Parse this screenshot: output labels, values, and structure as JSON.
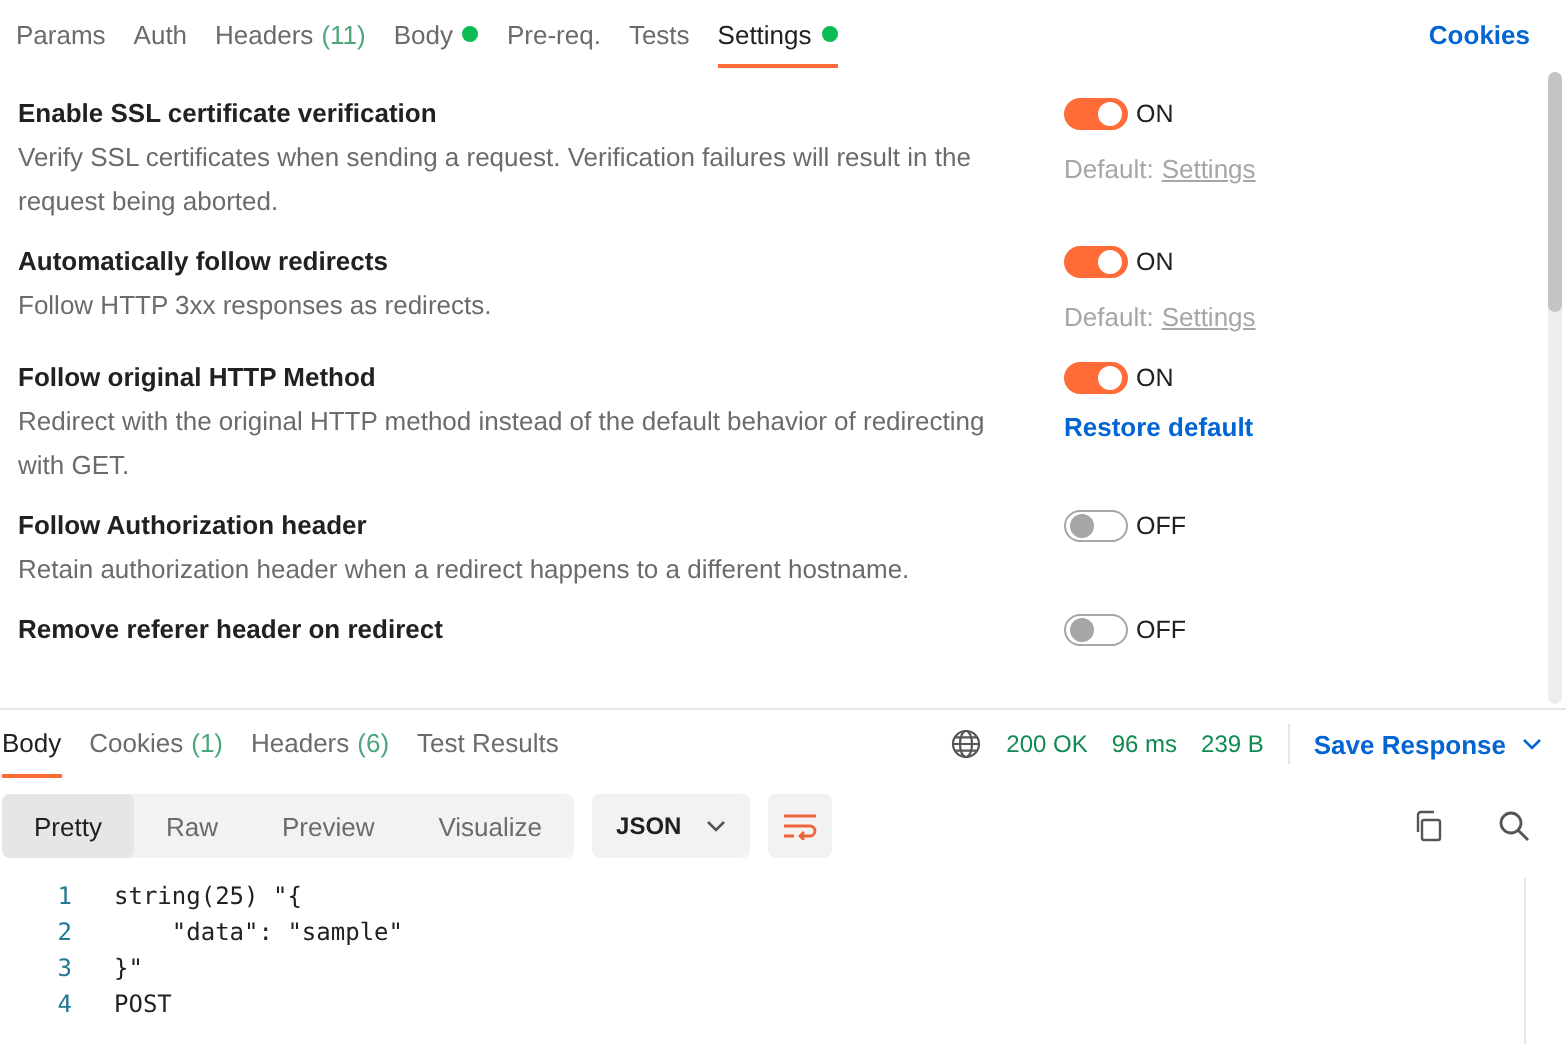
{
  "request_tabs": [
    {
      "label": "Params",
      "selected": false
    },
    {
      "label": "Auth",
      "selected": false
    },
    {
      "label": "Headers",
      "count": "(11)",
      "selected": false
    },
    {
      "label": "Body",
      "dot": true,
      "selected": false
    },
    {
      "label": "Pre-req.",
      "selected": false
    },
    {
      "label": "Tests",
      "selected": false
    },
    {
      "label": "Settings",
      "dot": true,
      "selected": true
    }
  ],
  "cookies_link": "Cookies",
  "settings": [
    {
      "title": "Enable SSL certificate verification",
      "description": "Verify SSL certificates when sending a request. Verification failures will result in the request being aborted.",
      "on": true,
      "state_label": "ON",
      "hint": {
        "kind": "default",
        "prefix": "Default:",
        "link": "Settings"
      }
    },
    {
      "title": "Automatically follow redirects",
      "description": "Follow HTTP 3xx responses as redirects.",
      "on": true,
      "state_label": "ON",
      "hint": {
        "kind": "default",
        "prefix": "Default:",
        "link": "Settings"
      }
    },
    {
      "title": "Follow original HTTP Method",
      "description": "Redirect with the original HTTP method instead of the default behavior of redirecting with GET.",
      "on": true,
      "state_label": "ON",
      "hint": {
        "kind": "restore",
        "link": "Restore default"
      }
    },
    {
      "title": "Follow Authorization header",
      "description": "Retain authorization header when a redirect happens to a different hostname.",
      "on": false,
      "state_label": "OFF"
    },
    {
      "title": "Remove referer header on redirect",
      "on": false,
      "state_label": "OFF"
    }
  ],
  "response_tabs": [
    {
      "label": "Body",
      "selected": true
    },
    {
      "label": "Cookies",
      "count": "(1)",
      "selected": false
    },
    {
      "label": "Headers",
      "count": "(6)",
      "selected": false
    },
    {
      "label": "Test Results",
      "selected": false
    }
  ],
  "status": {
    "code": "200 OK",
    "time": "96 ms",
    "size": "239 B"
  },
  "save_response": "Save Response",
  "view_modes": [
    {
      "label": "Pretty",
      "selected": true
    },
    {
      "label": "Raw",
      "selected": false
    },
    {
      "label": "Preview",
      "selected": false
    },
    {
      "label": "Visualize",
      "selected": false
    }
  ],
  "format": "JSON",
  "code_lines": [
    {
      "number": "1",
      "text": "string(25) \"{"
    },
    {
      "number": "2",
      "text": "    \"data\": \"sample\""
    },
    {
      "number": "3",
      "text": "}\""
    },
    {
      "number": "4",
      "text": "POST"
    }
  ]
}
